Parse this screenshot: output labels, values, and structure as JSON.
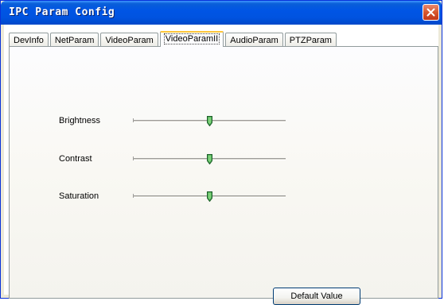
{
  "window": {
    "title": "IPC Param Config"
  },
  "tabs": [
    {
      "label": "DevInfo",
      "active": false
    },
    {
      "label": "NetParam",
      "active": false
    },
    {
      "label": "VideoParam",
      "active": false
    },
    {
      "label": "VideoParamII",
      "active": true
    },
    {
      "label": "AudioParam",
      "active": false
    },
    {
      "label": "PTZParam",
      "active": false
    }
  ],
  "settings": {
    "brightness": {
      "label": "Brightness",
      "value_fraction": 0.5
    },
    "contrast": {
      "label": "Contrast",
      "value_fraction": 0.5
    },
    "saturation": {
      "label": "Saturation",
      "value_fraction": 0.5
    }
  },
  "buttons": {
    "default_value": "Default Value"
  },
  "colors": {
    "titlebar": "#0055e5",
    "close": "#d6572e",
    "thumb": "#3aa04a",
    "tab_highlight": "#ffc73c"
  }
}
